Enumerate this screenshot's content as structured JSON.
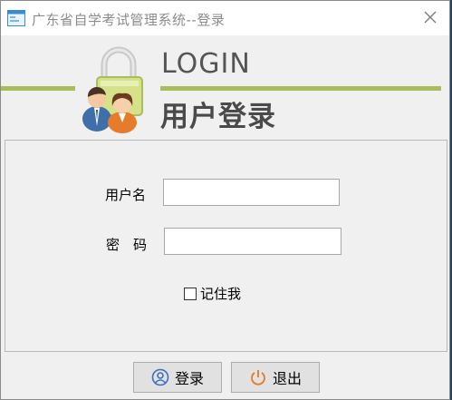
{
  "window": {
    "title": "广东省自学考试管理系统--登录",
    "icons": {
      "app": "window-app-icon",
      "close": "close-icon"
    }
  },
  "banner": {
    "login_word": "LOGIN",
    "login_cn": "用户登录",
    "logo_icon": "users-lock-icon",
    "accent_color": "#a9bd5c"
  },
  "form": {
    "username_label": "用户名",
    "username_value": "",
    "password_label": "密　码",
    "password_value": "",
    "remember_label": "记住我",
    "remember_checked": false
  },
  "buttons": {
    "login_label": "登录",
    "login_icon": "user-circle-icon",
    "exit_label": "退出",
    "exit_icon": "power-icon"
  }
}
